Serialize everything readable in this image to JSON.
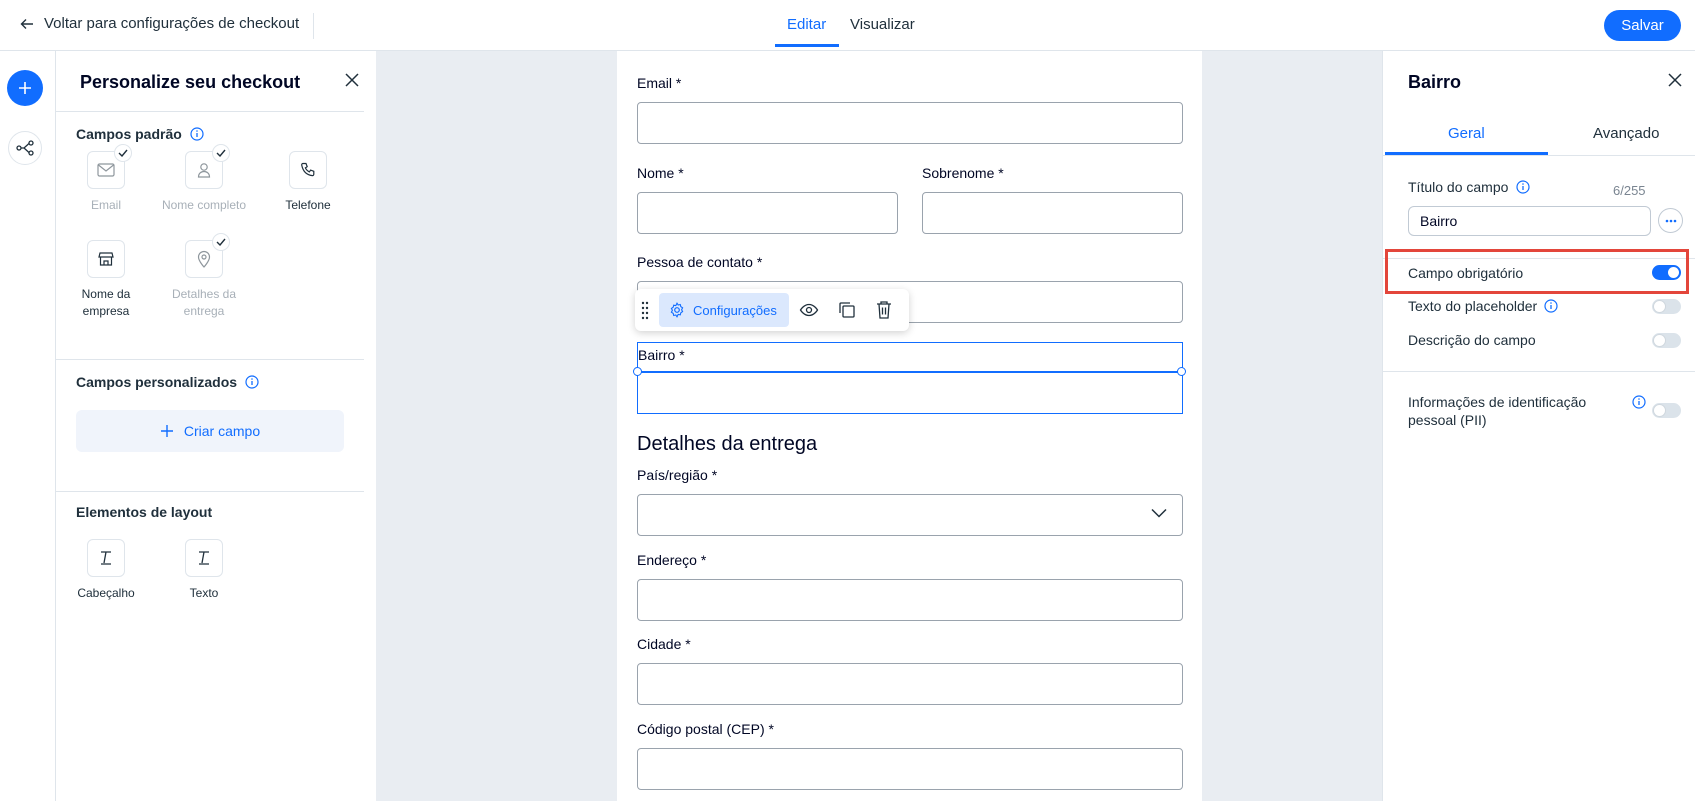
{
  "colors": {
    "accent": "#116dff",
    "highlight": "#e3463b",
    "canvas": "#e9edf2"
  },
  "topbar": {
    "back_label": "Voltar para configurações de checkout",
    "tab_edit": "Editar",
    "tab_view": "Visualizar",
    "save_label": "Salvar"
  },
  "left_panel": {
    "title": "Personalize seu checkout",
    "default_fields_title": "Campos padrão",
    "default_fields": [
      {
        "label": "Email",
        "icon": "mail-icon",
        "added": true
      },
      {
        "label": "Nome completo",
        "icon": "person-icon",
        "added": true
      },
      {
        "label": "Telefone",
        "icon": "phone-icon",
        "added": false
      },
      {
        "label": "Nome da empresa",
        "icon": "store-icon",
        "added": false
      },
      {
        "label": "Detalhes da entrega",
        "icon": "location-pin-icon",
        "added": true
      }
    ],
    "custom_fields_title": "Campos personalizados",
    "create_field_label": "Criar campo",
    "layout_title": "Elementos de layout",
    "layout_items": [
      {
        "label": "Cabeçalho",
        "icon": "text-t-icon"
      },
      {
        "label": "Texto",
        "icon": "text-t-icon"
      }
    ]
  },
  "form": {
    "email_label": "Email *",
    "first_name_label": "Nome *",
    "last_name_label": "Sobrenome *",
    "contact_label": "Pessoa de contato *",
    "neighborhood_label": "Bairro *",
    "delivery_section": "Detalhes da entrega",
    "country_label": "País/região *",
    "address_label": "Endereço *",
    "city_label": "Cidade *",
    "postal_label": "Código postal (CEP) *"
  },
  "toolbar": {
    "settings_label": "Configurações"
  },
  "right_panel": {
    "title": "Bairro",
    "tab_general": "Geral",
    "tab_advanced": "Avançado",
    "field_title_label": "Título do campo",
    "field_title_count": "6/255",
    "field_title_value": "Bairro",
    "required_label": "Campo obrigatório",
    "required_on": true,
    "placeholder_label": "Texto do placeholder",
    "placeholder_on": false,
    "description_label": "Descrição do campo",
    "description_on": false,
    "pii_label": "Informações de identificação pessoal (PII)",
    "pii_on": false
  }
}
